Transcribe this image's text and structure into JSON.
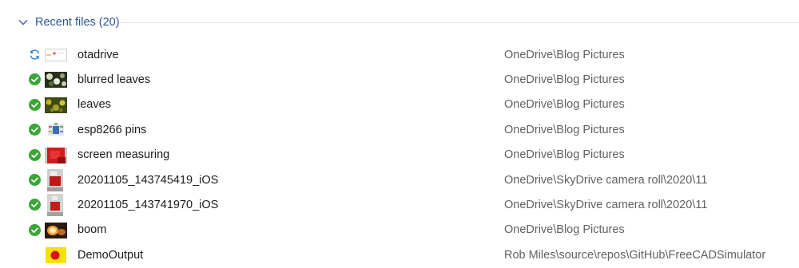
{
  "section": {
    "title": "Recent files (20)",
    "chevron_icon": "chevron-down-icon",
    "accent_color": "#2b5797"
  },
  "colors": {
    "synced_green": "#3aa635",
    "syncing_blue": "#2a7fd6",
    "location_gray": "#616161"
  },
  "files": [
    {
      "name": "otadrive",
      "location": "OneDrive\\Blog Pictures",
      "status": "syncing-icon",
      "thumb": "otadrive"
    },
    {
      "name": "blurred leaves",
      "location": "OneDrive\\Blog Pictures",
      "status": "synced-check-icon",
      "thumb": "blurred-leaves"
    },
    {
      "name": "leaves",
      "location": "OneDrive\\Blog Pictures",
      "status": "synced-check-icon",
      "thumb": "leaves"
    },
    {
      "name": "esp8266 pins",
      "location": "OneDrive\\Blog Pictures",
      "status": "synced-check-icon",
      "thumb": "esp8266"
    },
    {
      "name": "screen measuring",
      "location": "OneDrive\\Blog Pictures",
      "status": "synced-check-icon",
      "thumb": "screen-measuring"
    },
    {
      "name": "20201105_143745419_iOS",
      "location": "OneDrive\\SkyDrive camera roll\\2020\\11",
      "status": "synced-check-icon",
      "thumb": "photo-red-1"
    },
    {
      "name": "20201105_143741970_iOS",
      "location": "OneDrive\\SkyDrive camera roll\\2020\\11",
      "status": "synced-check-icon",
      "thumb": "photo-red-2"
    },
    {
      "name": "boom",
      "location": "OneDrive\\Blog Pictures",
      "status": "synced-check-icon",
      "thumb": "boom"
    },
    {
      "name": "DemoOutput",
      "location": "Rob Miles\\source\\repos\\GitHub\\FreeCADSimulator",
      "status": "none",
      "thumb": "demo-output"
    }
  ]
}
